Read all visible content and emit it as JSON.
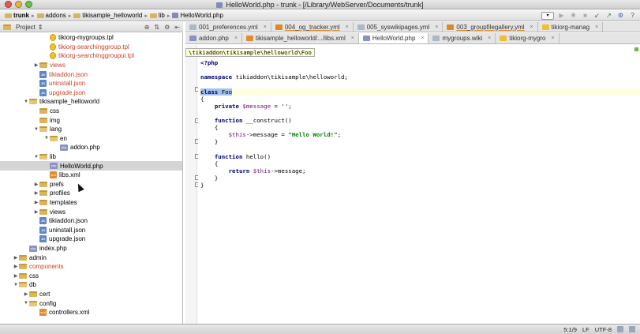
{
  "window": {
    "title": "HelloWorld.php - trunk - [/Library/WebServer/Documents/trunk]"
  },
  "breadcrumbs": [
    "trunk",
    "addons",
    "tikisample_helloworld",
    "lib",
    "HelloWorld.php"
  ],
  "toolbar": {
    "dropdown_label": "▾"
  },
  "project_panel": {
    "label": "Project"
  },
  "tree": [
    {
      "label": "tikiorg-mygroups.tpl",
      "indent": 3,
      "icon": "tpl",
      "color": "normal",
      "arrow": ""
    },
    {
      "label": "tikiorg-searchinggroup.tpl",
      "indent": 3,
      "icon": "tpl",
      "color": "red",
      "arrow": ""
    },
    {
      "label": "tikiorg-searchinggroupui.tpl",
      "indent": 3,
      "icon": "tpl",
      "color": "red",
      "arrow": ""
    },
    {
      "label": "views",
      "indent": 2,
      "icon": "folder",
      "color": "red",
      "arrow": "right"
    },
    {
      "label": "tikiaddon.json",
      "indent": 2,
      "icon": "json",
      "color": "red",
      "arrow": ""
    },
    {
      "label": "uninstall.json",
      "indent": 2,
      "icon": "json",
      "color": "red",
      "arrow": ""
    },
    {
      "label": "upgrade.json",
      "indent": 2,
      "icon": "json",
      "color": "red",
      "arrow": ""
    },
    {
      "label": "tikisample_helloworld",
      "indent": 1,
      "icon": "folder",
      "color": "normal",
      "arrow": "down"
    },
    {
      "label": "css",
      "indent": 2,
      "icon": "folder",
      "color": "normal",
      "arrow": ""
    },
    {
      "label": "img",
      "indent": 2,
      "icon": "folder",
      "color": "normal",
      "arrow": ""
    },
    {
      "label": "lang",
      "indent": 2,
      "icon": "folder",
      "color": "normal",
      "arrow": "down"
    },
    {
      "label": "en",
      "indent": 3,
      "icon": "folder",
      "color": "normal",
      "arrow": "down"
    },
    {
      "label": "addon.php",
      "indent": 4,
      "icon": "php",
      "color": "normal",
      "arrow": ""
    },
    {
      "label": "lib",
      "indent": 2,
      "icon": "folder",
      "color": "normal",
      "arrow": "down"
    },
    {
      "label": "HelloWorld.php",
      "indent": 3,
      "icon": "php",
      "color": "normal",
      "arrow": "",
      "selected": true
    },
    {
      "label": "libs.xml",
      "indent": 3,
      "icon": "xml",
      "color": "normal",
      "arrow": ""
    },
    {
      "label": "prefs",
      "indent": 2,
      "icon": "folder",
      "color": "normal",
      "arrow": "right"
    },
    {
      "label": "profiles",
      "indent": 2,
      "icon": "folder",
      "color": "normal",
      "arrow": "right"
    },
    {
      "label": "templates",
      "indent": 2,
      "icon": "folder",
      "color": "normal",
      "arrow": "right"
    },
    {
      "label": "views",
      "indent": 2,
      "icon": "folder",
      "color": "normal",
      "arrow": "right"
    },
    {
      "label": "tikiaddon.json",
      "indent": 2,
      "icon": "json",
      "color": "normal",
      "arrow": ""
    },
    {
      "label": "uninstall.json",
      "indent": 2,
      "icon": "json",
      "color": "normal",
      "arrow": ""
    },
    {
      "label": "upgrade.json",
      "indent": 2,
      "icon": "json",
      "color": "normal",
      "arrow": ""
    },
    {
      "label": "index.php",
      "indent": 1,
      "icon": "php",
      "color": "normal",
      "arrow": ""
    },
    {
      "label": "admin",
      "indent": 0,
      "icon": "folder",
      "color": "normal",
      "arrow": "right"
    },
    {
      "label": "components",
      "indent": 0,
      "icon": "folder",
      "color": "red",
      "arrow": "right"
    },
    {
      "label": "css",
      "indent": 0,
      "icon": "folder",
      "color": "normal",
      "arrow": "right"
    },
    {
      "label": "db",
      "indent": 0,
      "icon": "folder",
      "color": "normal",
      "arrow": "down"
    },
    {
      "label": "cert",
      "indent": 1,
      "icon": "folder",
      "color": "normal",
      "arrow": "right"
    },
    {
      "label": "config",
      "indent": 1,
      "icon": "folder",
      "color": "normal",
      "arrow": "down"
    },
    {
      "label": "controllers.xml",
      "indent": 2,
      "icon": "xml",
      "color": "normal",
      "arrow": ""
    }
  ],
  "tabs_row1": [
    {
      "label": "001_preferences.yml",
      "color": "#aab9c9"
    },
    {
      "label": "004_og_tracker.yml",
      "color": "#d98a2a"
    },
    {
      "label": "005_syswikipages.yml",
      "color": "#aab9c9"
    },
    {
      "label": "003_groupfilegallery.yml",
      "color": "#d98a2a"
    },
    {
      "label": "tikiorg-manag",
      "color": "#f0c030"
    }
  ],
  "tabs_row2": [
    {
      "label": "addon.php",
      "color": "#8a92c4",
      "active": false
    },
    {
      "label": "tikisample_helloworld/.../libs.xml",
      "color": "#e48b2f",
      "active": false
    },
    {
      "label": "HelloWorld.php",
      "color": "#8a92c4",
      "active": true
    },
    {
      "label": "mygroups.wiki",
      "color": "#aab9c9",
      "active": false
    },
    {
      "label": "tikiorg-mygro",
      "color": "#f0c030",
      "active": false
    }
  ],
  "editor": {
    "tooltip": "\\tikiaddon\\tikisample\\helloworld\\Foo",
    "php_open": "<?php",
    "ns_kw": "namespace",
    "ns_name": " tikiaddon\\tikisample\\helloworld;",
    "class_kw": "class",
    "class_name": "Foo",
    "open_brace": "{",
    "private_kw": "private",
    "message_var": "$message",
    "message_assign": " = '';",
    "function_kw": "function",
    "construct_sig": " __construct()",
    "this_var": "$this",
    "arrow_msg": "->message = ",
    "hello_str": "\"Hello World!\"",
    "semicolon": ";",
    "close_brace": "}",
    "hello_sig": " hello()",
    "return_kw": "return",
    "return_rest": "->message;"
  },
  "status": {
    "position": "5:1/9",
    "line_ending": "LF",
    "encoding": "UTF-8"
  }
}
